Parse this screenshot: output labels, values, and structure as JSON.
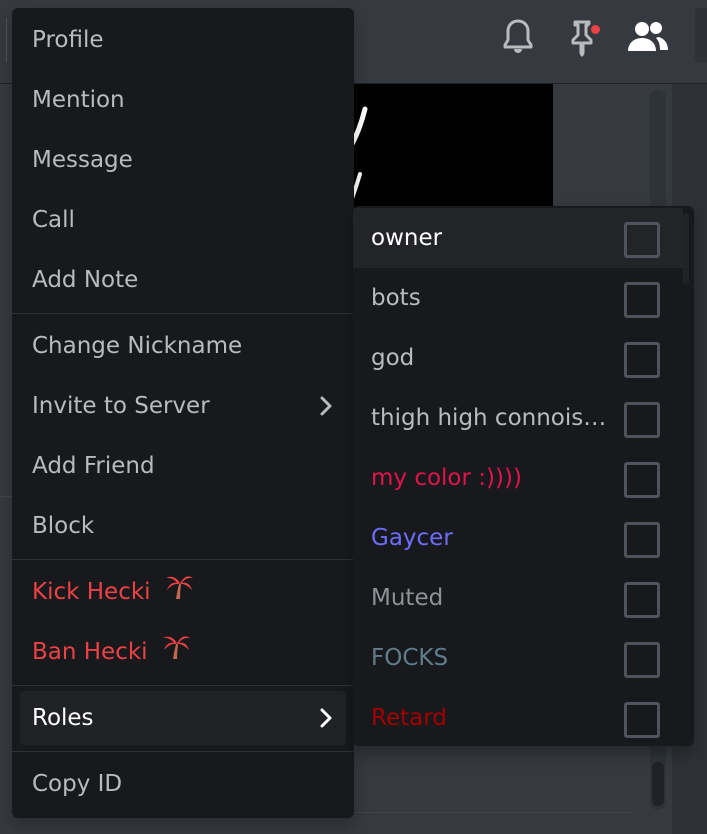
{
  "topbar": {
    "icons": [
      "bell-icon",
      "pin-icon",
      "members-icon"
    ],
    "pin_badge_color": "#ed4245"
  },
  "context_menu": {
    "groups": [
      [
        {
          "label": "Profile"
        },
        {
          "label": "Mention"
        },
        {
          "label": "Message"
        },
        {
          "label": "Call"
        },
        {
          "label": "Add Note"
        }
      ],
      [
        {
          "label": "Change Nickname"
        },
        {
          "label": "Invite to Server",
          "submenu": true
        },
        {
          "label": "Add Friend"
        },
        {
          "label": "Block"
        }
      ],
      [
        {
          "label": "Kick Hecki",
          "emoji": "palm-tree-icon",
          "danger": true
        },
        {
          "label": "Ban Hecki",
          "emoji": "palm-tree-icon",
          "danger": true
        }
      ],
      [
        {
          "label": "Roles",
          "submenu": true,
          "active": true
        }
      ],
      [
        {
          "label": "Copy ID"
        }
      ]
    ]
  },
  "roles_submenu": {
    "items": [
      {
        "name": "owner",
        "color": "#ffffff",
        "checked": false,
        "hover": true
      },
      {
        "name": "bots",
        "color": "#b9bbbe",
        "checked": false
      },
      {
        "name": "god",
        "color": "#b9bbbe",
        "checked": false
      },
      {
        "name": "thigh high connoisse...",
        "color": "#b9bbbe",
        "checked": false
      },
      {
        "name": "my color :))))",
        "color": "#e0144c",
        "checked": false
      },
      {
        "name": "Gaycer",
        "color": "#6c6cff",
        "checked": false
      },
      {
        "name": "Muted",
        "color": "#8e9297",
        "checked": false
      },
      {
        "name": "FOCKS",
        "color": "#607d8b",
        "checked": false
      },
      {
        "name": "Retard",
        "color": "#a30000",
        "checked": false
      }
    ]
  }
}
